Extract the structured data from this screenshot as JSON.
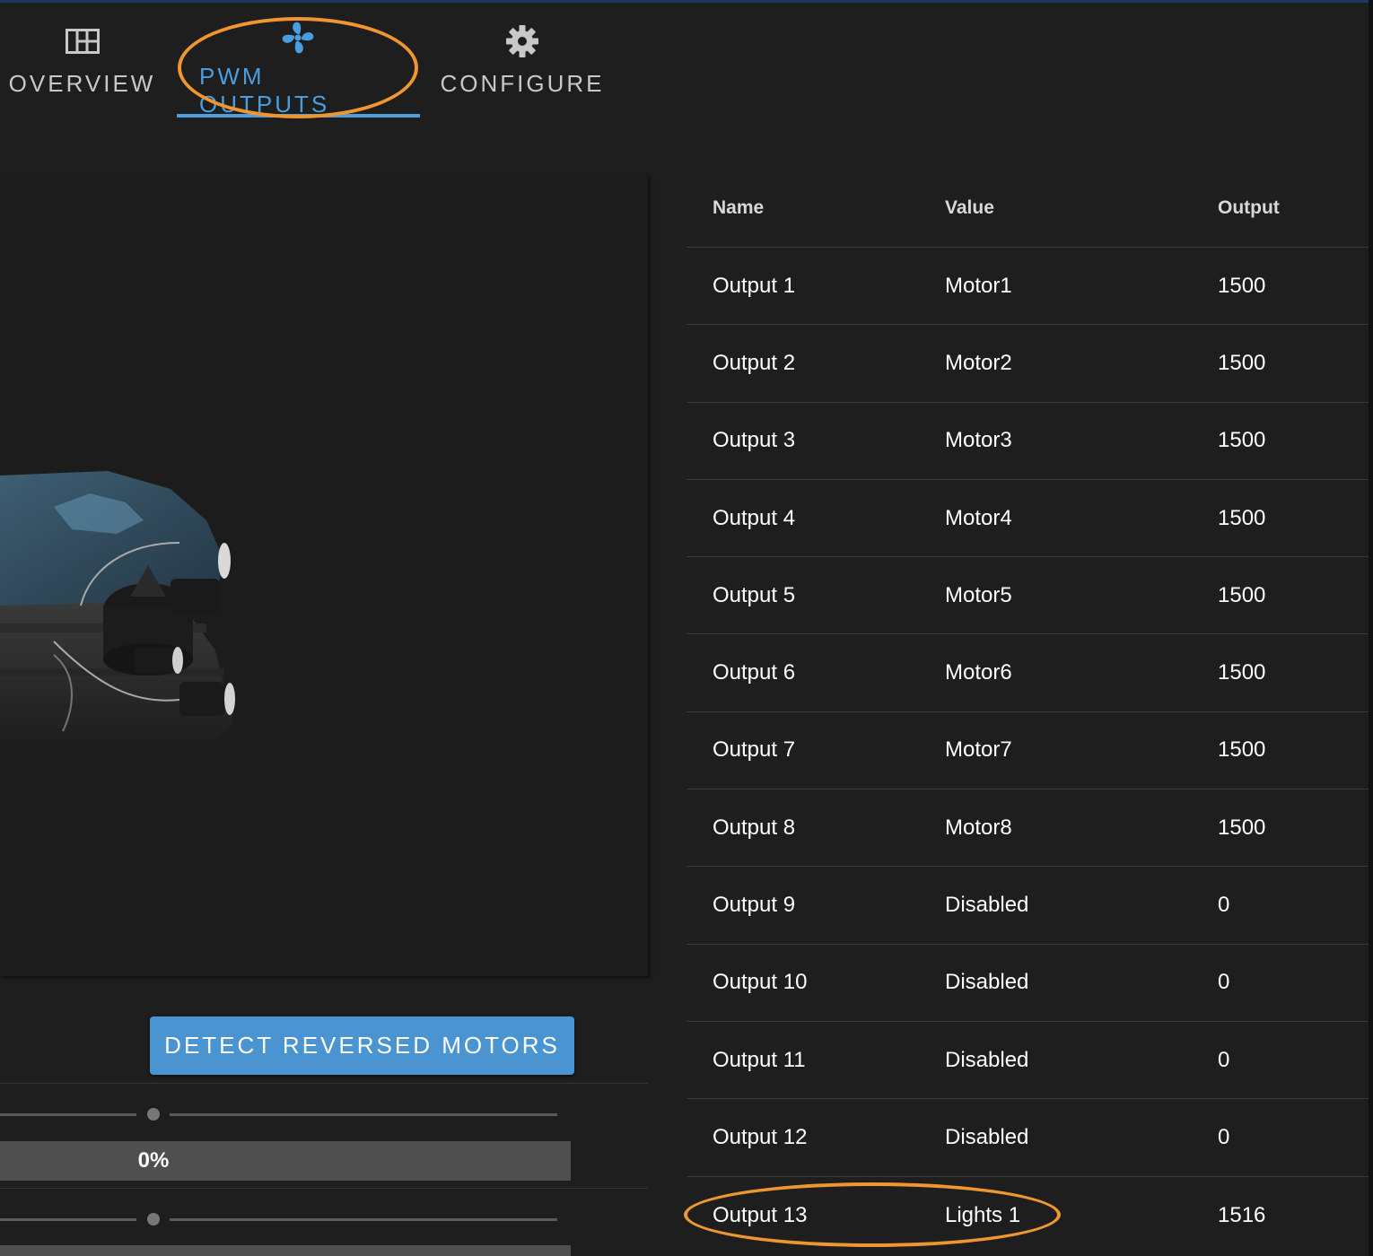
{
  "tabs": [
    {
      "label": "OVERVIEW",
      "icon": "overview-grid-icon",
      "active": false
    },
    {
      "label": "PWM OUTPUTS",
      "icon": "fan-icon",
      "active": true
    },
    {
      "label": "CONFIGURE",
      "icon": "gear-icon",
      "active": false
    }
  ],
  "colors": {
    "accent": "#4a9ee0",
    "button": "#4a94d2",
    "annotation": "#f0962f",
    "background": "#1e1e1e"
  },
  "actions": {
    "detect_label": "DETECT REVERSED MOTORS"
  },
  "progress": {
    "label": "0%",
    "value": 0
  },
  "table": {
    "headers": {
      "name": "Name",
      "value": "Value",
      "output": "Output"
    },
    "rows": [
      {
        "name": "Output 1",
        "value": "Motor1",
        "output": "1500"
      },
      {
        "name": "Output 2",
        "value": "Motor2",
        "output": "1500"
      },
      {
        "name": "Output 3",
        "value": "Motor3",
        "output": "1500"
      },
      {
        "name": "Output 4",
        "value": "Motor4",
        "output": "1500"
      },
      {
        "name": "Output 5",
        "value": "Motor5",
        "output": "1500"
      },
      {
        "name": "Output 6",
        "value": "Motor6",
        "output": "1500"
      },
      {
        "name": "Output 7",
        "value": "Motor7",
        "output": "1500"
      },
      {
        "name": "Output 8",
        "value": "Motor8",
        "output": "1500"
      },
      {
        "name": "Output 9",
        "value": "Disabled",
        "output": "0"
      },
      {
        "name": "Output 10",
        "value": "Disabled",
        "output": "0"
      },
      {
        "name": "Output 11",
        "value": "Disabled",
        "output": "0"
      },
      {
        "name": "Output 12",
        "value": "Disabled",
        "output": "0"
      },
      {
        "name": "Output 13",
        "value": "Lights 1",
        "output": "1516"
      }
    ]
  }
}
